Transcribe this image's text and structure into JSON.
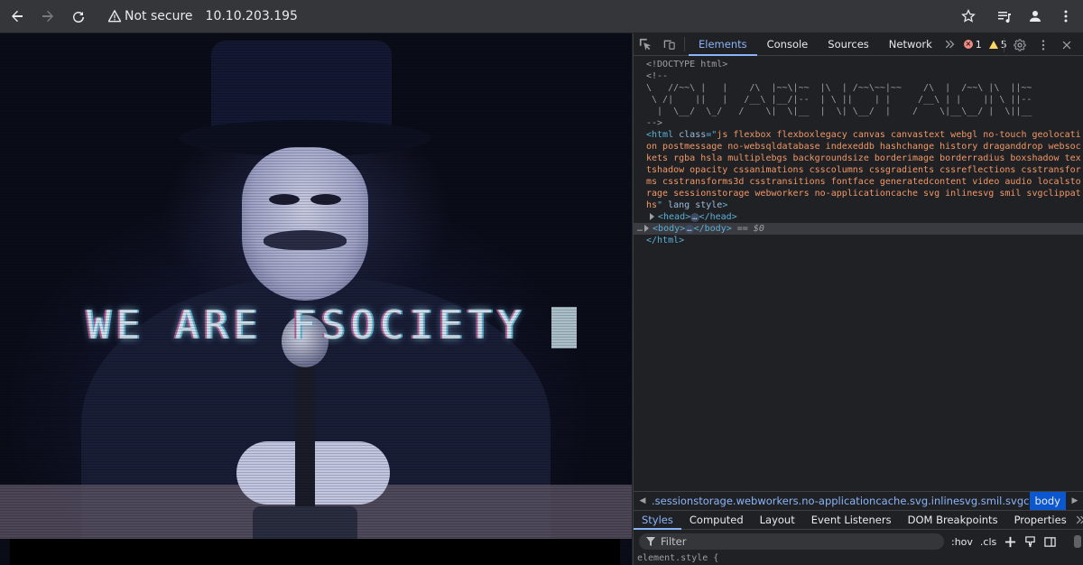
{
  "browser": {
    "security_label": "Not secure",
    "url": "10.10.203.195"
  },
  "page": {
    "headline": "WE ARE FSOCIETY"
  },
  "devtools": {
    "tabs": [
      "Elements",
      "Console",
      "Sources",
      "Network"
    ],
    "error_count": "1",
    "warning_count": "5",
    "dom": {
      "doctype": "<!DOCTYPE html>",
      "comment_open": "<!--",
      "ascii_art": [
        "\\   //~~\\ |   |    /\\  |~~\\|~~  |\\  | /~~\\~~|~~    /\\  |  /~~\\ |\\  ||~~",
        " \\ /|    ||   |   /__\\ |__/|--  | \\ ||    | |     /__\\ | |    || \\ ||--",
        "  |  \\__/  \\_/   /    \\|  \\|__  |  \\| \\__/  |    /    \\|__\\__/ |  \\||__"
      ],
      "comment_close": "-->",
      "html_class": "js flexbox flexboxlegacy canvas canvastext webgl no-touch geolocation postmessage no-websqldatabase indexeddb hashchange history draganddrop websockets rgba hsla multiplebgs backgroundsize borderimage borderradius boxshadow textshadow opacity cssanimations csscolumns cssgradients cssreflections csstransforms csstransforms3d csstransitions fontface generatedcontent video audio localstorage sessionstorage webworkers no-applicationcache svg inlinesvg smil svgclippaths",
      "html_extra_attrs": "lang style",
      "head_open": "<head>",
      "head_close": "</head>",
      "body_open": "<body>",
      "body_close": "</body>",
      "selected_marker": "== $0",
      "html_close": "</html>",
      "row_dots": "…"
    },
    "breadcrumb": {
      "path": ".sessionstorage.webworkers.no-applicationcache.svg.inlinesvg.smil.svgclippaths",
      "current": "body"
    },
    "sub_tabs": [
      "Styles",
      "Computed",
      "Layout",
      "Event Listeners",
      "DOM Breakpoints",
      "Properties"
    ],
    "filter_placeholder": "Filter",
    "hov_label": ":hov",
    "cls_label": ".cls",
    "element_style": "element.style {"
  }
}
